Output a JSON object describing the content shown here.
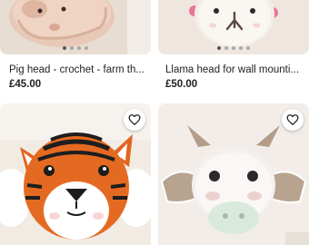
{
  "listings": [
    {
      "title": "Pig head - crochet - farm th...",
      "price": "£45.00",
      "image_icon": "pig-head-photo",
      "carousel_dots": 4,
      "carousel_active": 0
    },
    {
      "title": "Llama head for wall mounti...",
      "price": "£50.00",
      "image_icon": "llama-head-photo",
      "carousel_dots": 5,
      "carousel_active": 0
    },
    {
      "title": "",
      "price": "",
      "image_icon": "tiger-head-photo",
      "favorite_icon": "heart-outline-icon"
    },
    {
      "title": "",
      "price": "",
      "image_icon": "dragon-head-photo",
      "favorite_icon": "heart-outline-icon"
    }
  ],
  "colors": {
    "text": "#222222",
    "dot_active": "#555555",
    "dot_inactive": "#9a9a9a"
  }
}
